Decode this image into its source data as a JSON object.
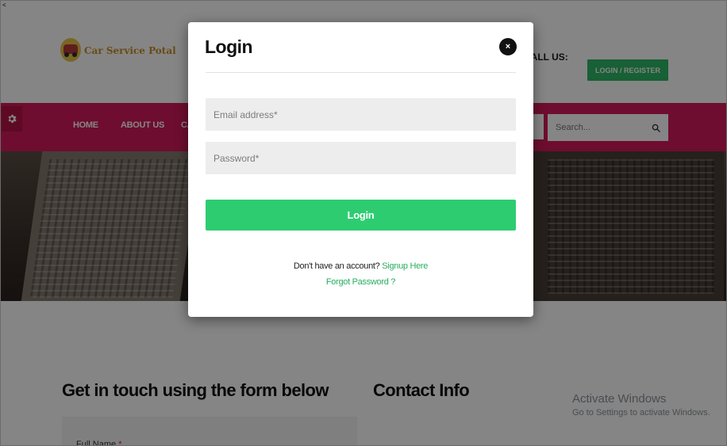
{
  "header": {
    "logo_text": "Car Service Potal",
    "call_us_label": "CALL US:",
    "login_register_label": "LOGIN / REGISTER"
  },
  "nav": {
    "items": [
      {
        "label": "HOME"
      },
      {
        "label": "ABOUT US"
      },
      {
        "label": "CA"
      }
    ],
    "search_placeholder": "Search..."
  },
  "main": {
    "form_title": "Get in touch using the form below",
    "contact_title": "Contact Info",
    "full_name_label": "Full Name",
    "required_marker": "*"
  },
  "modal": {
    "title": "Login",
    "close_label": "×",
    "email_placeholder": "Email address*",
    "password_placeholder": "Password*",
    "login_button_label": "Login",
    "no_account_text": "Don't have an account?",
    "signup_link": "Signup Here",
    "forgot_link": "Forgot Password ?"
  },
  "watermark": {
    "title": "Activate Windows",
    "subtitle": "Go to Settings to activate Windows."
  },
  "colors": {
    "nav_bg": "#d41a5a",
    "accent_green": "#2ecc71",
    "login_register_bg": "#2fb866",
    "link_green": "#27ae60"
  },
  "icons": {
    "settings": "gear-icon",
    "search": "search-icon",
    "close": "close-icon",
    "logo": "car-logo-icon"
  }
}
